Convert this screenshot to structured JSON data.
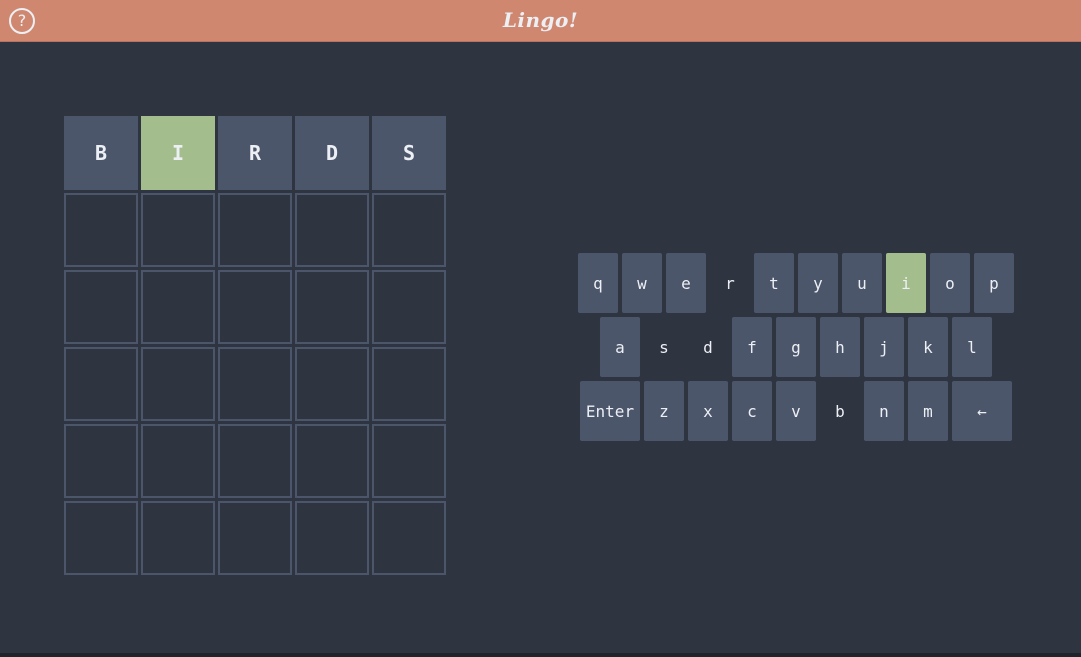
{
  "header": {
    "title": "Lingo!",
    "help_icon": "?"
  },
  "colors": {
    "header": "#d08770",
    "background": "#2e3440",
    "tile": "#4c566a",
    "correct": "#a3be8c",
    "text": "#eceff4"
  },
  "board": {
    "rows": [
      [
        {
          "letter": "B",
          "state": "filled"
        },
        {
          "letter": "I",
          "state": "correct"
        },
        {
          "letter": "R",
          "state": "filled"
        },
        {
          "letter": "D",
          "state": "filled"
        },
        {
          "letter": "S",
          "state": "filled"
        }
      ],
      [
        {
          "letter": "",
          "state": "empty"
        },
        {
          "letter": "",
          "state": "empty"
        },
        {
          "letter": "",
          "state": "empty"
        },
        {
          "letter": "",
          "state": "empty"
        },
        {
          "letter": "",
          "state": "empty"
        }
      ],
      [
        {
          "letter": "",
          "state": "empty"
        },
        {
          "letter": "",
          "state": "empty"
        },
        {
          "letter": "",
          "state": "empty"
        },
        {
          "letter": "",
          "state": "empty"
        },
        {
          "letter": "",
          "state": "empty"
        }
      ],
      [
        {
          "letter": "",
          "state": "empty"
        },
        {
          "letter": "",
          "state": "empty"
        },
        {
          "letter": "",
          "state": "empty"
        },
        {
          "letter": "",
          "state": "empty"
        },
        {
          "letter": "",
          "state": "empty"
        }
      ],
      [
        {
          "letter": "",
          "state": "empty"
        },
        {
          "letter": "",
          "state": "empty"
        },
        {
          "letter": "",
          "state": "empty"
        },
        {
          "letter": "",
          "state": "empty"
        },
        {
          "letter": "",
          "state": "empty"
        }
      ],
      [
        {
          "letter": "",
          "state": "empty"
        },
        {
          "letter": "",
          "state": "empty"
        },
        {
          "letter": "",
          "state": "empty"
        },
        {
          "letter": "",
          "state": "empty"
        },
        {
          "letter": "",
          "state": "empty"
        }
      ]
    ]
  },
  "keyboard": {
    "rows": [
      [
        {
          "label": "q",
          "state": "unused"
        },
        {
          "label": "w",
          "state": "unused"
        },
        {
          "label": "e",
          "state": "unused"
        },
        {
          "label": "r",
          "state": "absent"
        },
        {
          "label": "t",
          "state": "unused"
        },
        {
          "label": "y",
          "state": "unused"
        },
        {
          "label": "u",
          "state": "unused"
        },
        {
          "label": "i",
          "state": "correct"
        },
        {
          "label": "o",
          "state": "unused"
        },
        {
          "label": "p",
          "state": "unused"
        }
      ],
      [
        {
          "label": "a",
          "state": "unused"
        },
        {
          "label": "s",
          "state": "absent"
        },
        {
          "label": "d",
          "state": "absent"
        },
        {
          "label": "f",
          "state": "unused"
        },
        {
          "label": "g",
          "state": "unused"
        },
        {
          "label": "h",
          "state": "unused"
        },
        {
          "label": "j",
          "state": "unused"
        },
        {
          "label": "k",
          "state": "unused"
        },
        {
          "label": "l",
          "state": "unused"
        }
      ],
      [
        {
          "label": "Enter",
          "state": "unused"
        },
        {
          "label": "z",
          "state": "unused"
        },
        {
          "label": "x",
          "state": "unused"
        },
        {
          "label": "c",
          "state": "unused"
        },
        {
          "label": "v",
          "state": "unused"
        },
        {
          "label": "b",
          "state": "absent"
        },
        {
          "label": "n",
          "state": "unused"
        },
        {
          "label": "m",
          "state": "unused"
        },
        {
          "label": "←",
          "state": "unused"
        }
      ]
    ]
  }
}
